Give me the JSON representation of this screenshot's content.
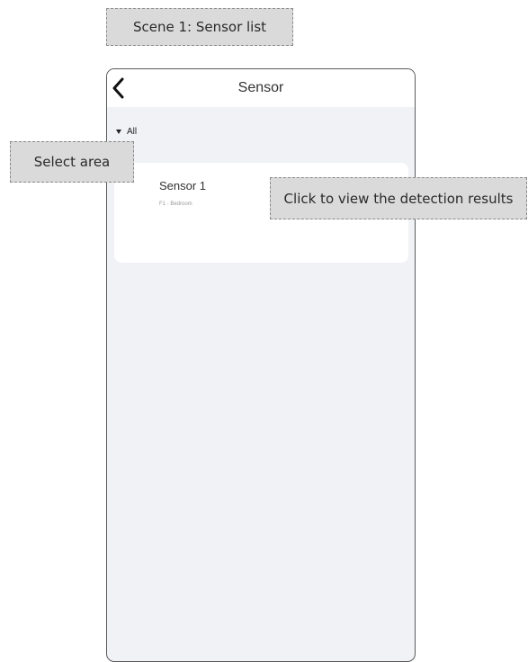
{
  "annotations": {
    "scene": "Scene 1: Sensor list",
    "select_area": "Select area",
    "detection": "Click to view the detection results"
  },
  "header": {
    "back_icon": "chevron-left-icon",
    "title": "Sensor"
  },
  "filter": {
    "caret_icon": "caret-down-icon",
    "label": "All"
  },
  "sensors": [
    {
      "name": "Sensor 1",
      "location": "F1 - Bedroom"
    }
  ]
}
